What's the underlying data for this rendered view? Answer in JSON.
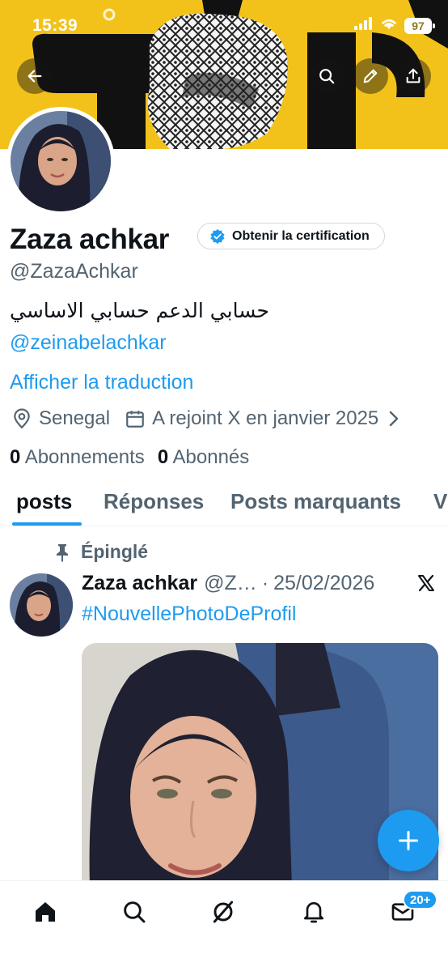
{
  "status_bar": {
    "time": "15:39",
    "battery": "97"
  },
  "banner": {
    "colors": {
      "background": "#f2c21b",
      "letters": "#111111"
    }
  },
  "header_buttons": [
    "back-arrow-icon",
    "search-icon",
    "edit-pencil-icon",
    "share-icon"
  ],
  "profile": {
    "name": "Zaza achkar",
    "certification_label": "Obtenir la certification",
    "handle": "@ZazaAchkar",
    "bio": "حسابي الدعم حسابي الاساسي",
    "bio_link": "@zeinabelachkar",
    "translate_label": "Afficher la traduction",
    "location": "Senegal",
    "joined": "A rejoint X en janvier 2025",
    "following_count": "0",
    "following_label": "Abonnements",
    "followers_count": "0",
    "followers_label": "Abonnés"
  },
  "tabs": [
    {
      "label": "posts",
      "active": true
    },
    {
      "label": "Réponses",
      "active": false
    },
    {
      "label": "Posts marquants",
      "active": false
    },
    {
      "label": "V",
      "active": false
    }
  ],
  "pinned_post": {
    "pinned_label": "Épinglé",
    "author_name": "Zaza achkar",
    "author_handle": "@Z…",
    "separator": "·",
    "date": "25/02/2026",
    "text": "#NouvellePhotoDeProfil"
  },
  "bottom_nav": {
    "items": [
      "home-icon",
      "search-icon",
      "grok-icon",
      "notifications-icon",
      "messages-icon"
    ],
    "messages_badge": "20+"
  },
  "accent_color": "#1d9bf0"
}
